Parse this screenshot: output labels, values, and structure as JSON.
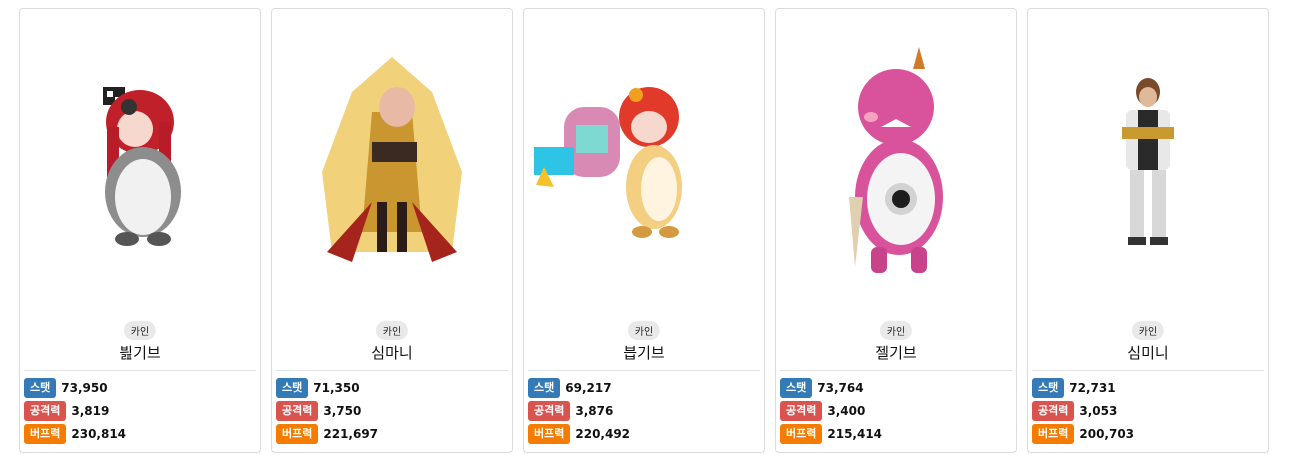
{
  "stat_colors": {
    "stat": "#337ab7",
    "attack": "#d9534f",
    "buff": "#f57c00"
  },
  "cards": [
    {
      "server": "카인",
      "name": "븶기브",
      "stats": [
        {
          "label": "스탯",
          "value": "73,950"
        },
        {
          "label": "공격력",
          "value": "3,819"
        },
        {
          "label": "버프력",
          "value": "230,814"
        }
      ]
    },
    {
      "server": "카인",
      "name": "심마니",
      "stats": [
        {
          "label": "스탯",
          "value": "71,350"
        },
        {
          "label": "공격력",
          "value": "3,750"
        },
        {
          "label": "버프력",
          "value": "221,697"
        }
      ]
    },
    {
      "server": "카인",
      "name": "븝기브",
      "stats": [
        {
          "label": "스탯",
          "value": "69,217"
        },
        {
          "label": "공격력",
          "value": "3,876"
        },
        {
          "label": "버프력",
          "value": "220,492"
        }
      ]
    },
    {
      "server": "카인",
      "name": "젤기브",
      "stats": [
        {
          "label": "스탯",
          "value": "73,764"
        },
        {
          "label": "공격력",
          "value": "3,400"
        },
        {
          "label": "버프력",
          "value": "215,414"
        }
      ]
    },
    {
      "server": "카인",
      "name": "심미니",
      "stats": [
        {
          "label": "스탯",
          "value": "72,731"
        },
        {
          "label": "공격력",
          "value": "3,053"
        },
        {
          "label": "버프력",
          "value": "200,703"
        }
      ]
    }
  ]
}
